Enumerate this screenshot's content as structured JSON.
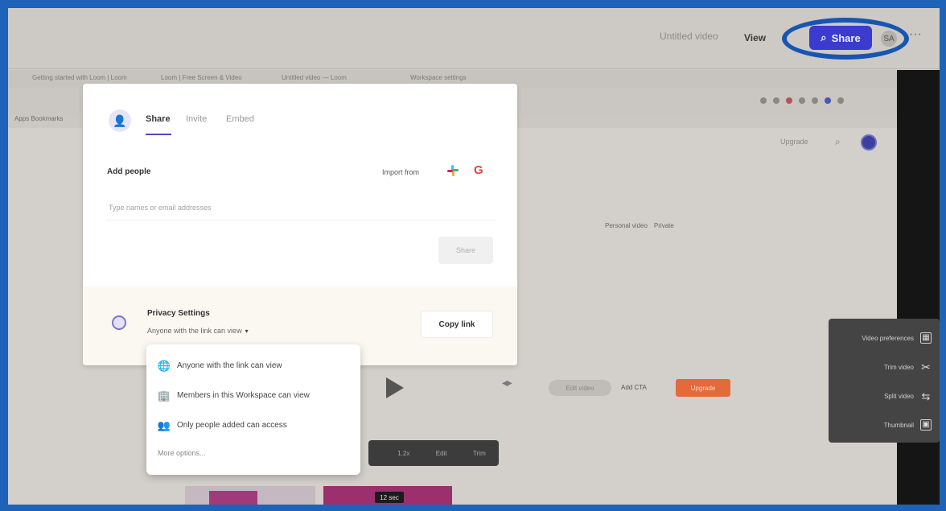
{
  "topbar": {
    "doc_title": "Untitled video",
    "view_label": "View",
    "share_label": "Share",
    "avatar_initials": "SA",
    "more": "···"
  },
  "tabs": [
    "Getting started with Loom | Loom",
    "Loom | Free Screen & Video",
    "Untitled video — Loom",
    "Workspace settings"
  ],
  "bookmarks": "Apps  Bookmarks",
  "canvas": {
    "top_right_label": "Upgrade",
    "chip_left": "Personal video",
    "chip_right": "Private",
    "grey_pill": "Edit video",
    "plain_text": "Add CTA",
    "orange_pill": "Upgrade",
    "darkbar_items": [
      "1.2x",
      "Edit",
      "Trim"
    ],
    "thumb_tag": "12 sec"
  },
  "right_menu": [
    {
      "label": "Video preferences",
      "icon": "layout-icon"
    },
    {
      "label": "Trim video",
      "icon": "scissors-icon"
    },
    {
      "label": "Split video",
      "icon": "split-icon"
    },
    {
      "label": "Thumbnail",
      "icon": "thumbnail-icon"
    }
  ],
  "modal": {
    "tabs": [
      "Share",
      "Invite",
      "Embed"
    ],
    "add_people": "Add people",
    "import_from": "Import from",
    "invite_placeholder": "Type names or email addresses",
    "share_button": "Share",
    "privacy_title": "Privacy Settings",
    "privacy_value": "Anyone with the link can view",
    "copy_link": "Copy link"
  },
  "dropdown": {
    "options": [
      {
        "label": "Anyone with the link can view",
        "icon": "globe-icon"
      },
      {
        "label": "Members in this Workspace can view",
        "icon": "building-icon"
      },
      {
        "label": "Only people added can access",
        "icon": "people-icon"
      }
    ],
    "more": "More options..."
  },
  "colors": {
    "frame": "#1f63b8",
    "share_button": "#3b3bd0",
    "accent": "#4a4ac8",
    "orange": "#e46a3a"
  }
}
